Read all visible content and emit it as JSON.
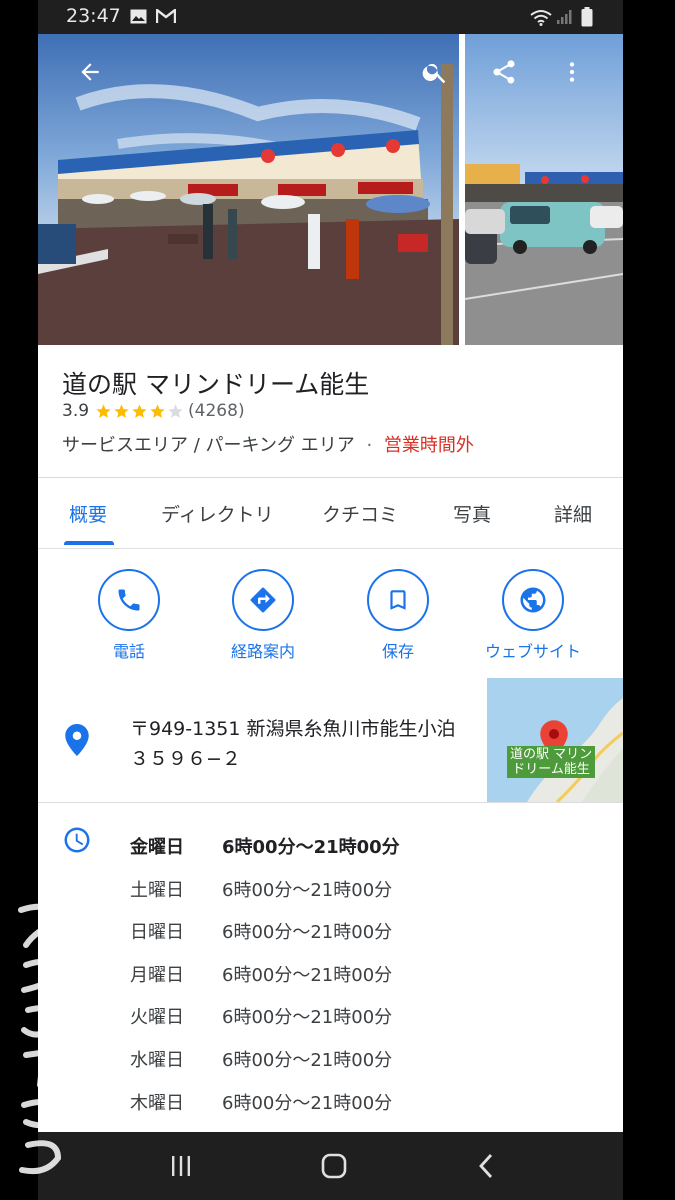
{
  "status_bar": {
    "time": "23:47"
  },
  "place": {
    "name": "道の駅 マリンドリーム能生",
    "rating": "3.9",
    "rating_value": 3.9,
    "review_count": "(4268)",
    "category": "サービスエリア / パーキング エリア",
    "separator": "·",
    "open_status": "営業時間外"
  },
  "tabs": [
    {
      "label": "概要",
      "active": true
    },
    {
      "label": "ディレクトリ"
    },
    {
      "label": "クチコミ"
    },
    {
      "label": "写真"
    },
    {
      "label": "詳細"
    }
  ],
  "actions": [
    {
      "label": "電話",
      "icon": "phone-icon"
    },
    {
      "label": "経路案内",
      "icon": "directions-icon"
    },
    {
      "label": "保存",
      "icon": "bookmark-icon"
    },
    {
      "label": "ウェブサイト",
      "icon": "globe-icon"
    }
  ],
  "address": {
    "text": "〒949-1351 新潟県糸魚川市能生小泊３５９６−２",
    "map_label_line1": "道の駅 マリン",
    "map_label_line2": "ドリーム能生"
  },
  "hours": [
    {
      "day": "金曜日",
      "time": "6時00分～21時00分",
      "today": true
    },
    {
      "day": "土曜日",
      "time": "6時00分～21時00分"
    },
    {
      "day": "日曜日",
      "time": "6時00分～21時00分"
    },
    {
      "day": "月曜日",
      "time": "6時00分～21時00分"
    },
    {
      "day": "火曜日",
      "time": "6時00分～21時00分"
    },
    {
      "day": "水曜日",
      "time": "6時00分～21時00分"
    },
    {
      "day": "木曜日",
      "time": "6時00分～21時00分"
    }
  ],
  "colors": {
    "accent": "#1a73e8",
    "closed": "#d93025",
    "star": "#fbbc04",
    "pin": "#ea4335"
  }
}
